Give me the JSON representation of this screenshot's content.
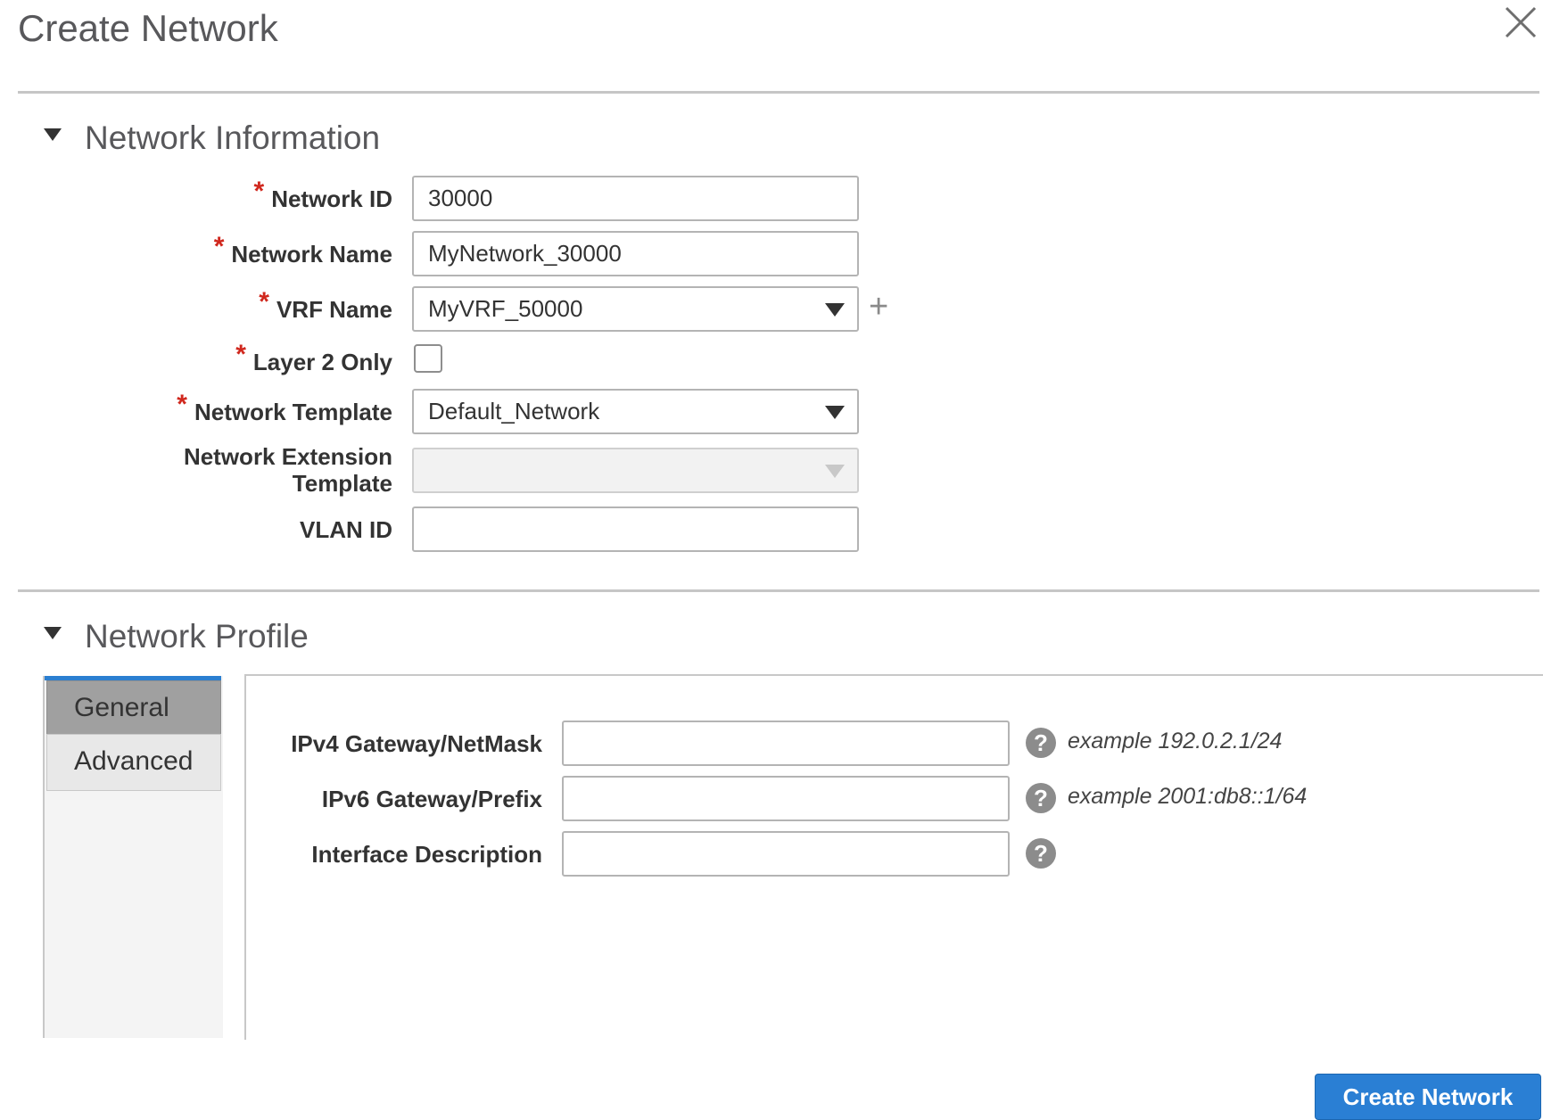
{
  "dialog": {
    "title": "Create Network",
    "close_icon": "close-icon"
  },
  "network_information": {
    "section_title": "Network Information",
    "fields": {
      "network_id": {
        "label": "Network ID",
        "required": "*",
        "value": "30000"
      },
      "network_name": {
        "label": "Network Name",
        "required": "*",
        "value": "MyNetwork_30000"
      },
      "vrf_name": {
        "label": "VRF Name",
        "required": "*",
        "value": "MyVRF_50000"
      },
      "layer2_only": {
        "label": "Layer 2 Only",
        "required": "*",
        "checked": false
      },
      "network_template": {
        "label": "Network Template",
        "required": "*",
        "value": "Default_Network"
      },
      "network_extension_template": {
        "label": "Network Extension Template",
        "value": ""
      },
      "vlan_id": {
        "label": "VLAN ID",
        "value": ""
      }
    },
    "add_icon_glyph": "+"
  },
  "network_profile": {
    "section_title": "Network Profile",
    "tabs": [
      {
        "label": "General",
        "active": true
      },
      {
        "label": "Advanced",
        "active": false
      }
    ],
    "fields": {
      "ipv4": {
        "label": "IPv4 Gateway/NetMask",
        "value": "",
        "hint": "example 192.0.2.1/24"
      },
      "ipv6": {
        "label": "IPv6 Gateway/Prefix",
        "value": "",
        "hint": "example 2001:db8::1/64"
      },
      "interface_description": {
        "label": "Interface Description",
        "value": ""
      }
    },
    "help_glyph": "?"
  },
  "footer": {
    "create_button_label": "Create Network"
  },
  "colors": {
    "accent": "#2a7fd4",
    "required": "#d0271d",
    "active_tab": "#a0a0a0"
  }
}
